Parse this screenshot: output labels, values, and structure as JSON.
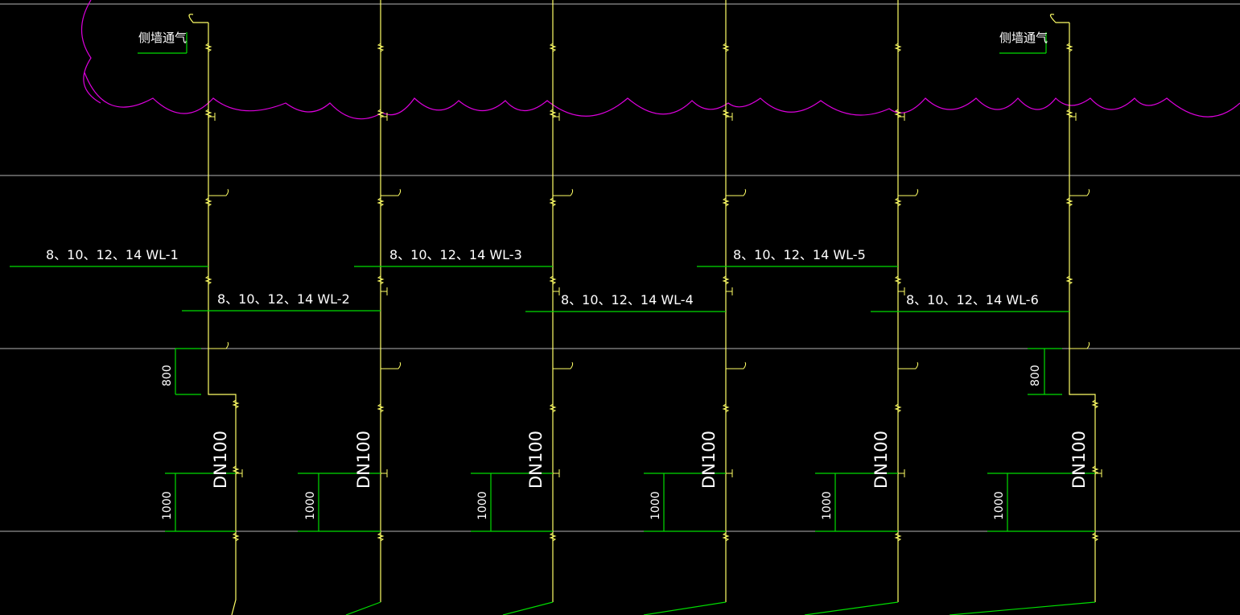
{
  "drawing": {
    "colors": {
      "background": "#000000",
      "pipe": "#ffff66",
      "branch": "#00dd00",
      "revision_cloud": "#dd00dd",
      "floor_line": "#b4b4b4",
      "text": "#ffffff"
    },
    "vent_labels": [
      "侧墙通气",
      "侧墙通气"
    ],
    "branch_labels": [
      "8、10、12、14 WL-1",
      "8、10、12、14 WL-2",
      "8、10、12、14 WL-3",
      "8、10、12、14 WL-4",
      "8、10、12、14 WL-5",
      "8、10、12、14 WL-6"
    ],
    "pipe_size_label": "DN100",
    "dimensions": {
      "offset_height": "800",
      "cleanout_height": "1000"
    }
  }
}
